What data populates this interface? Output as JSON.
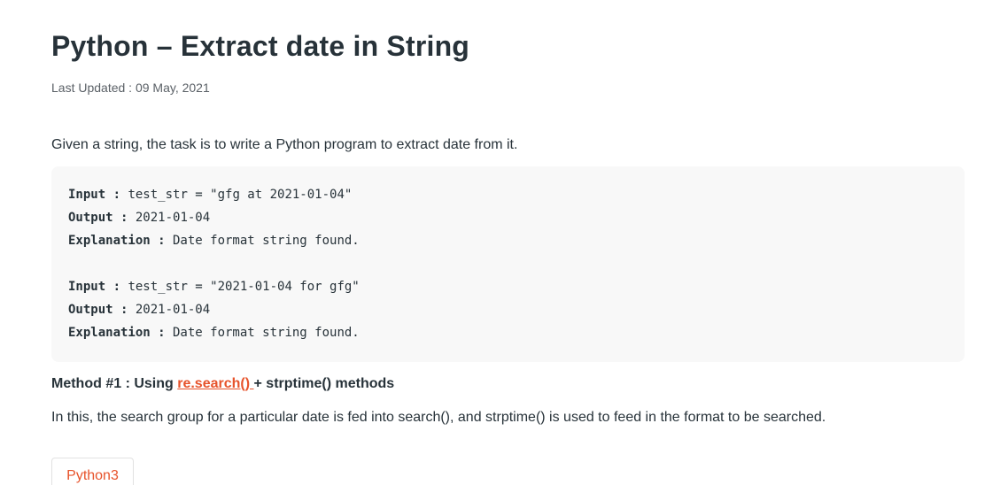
{
  "article": {
    "title": "Python – Extract date in String",
    "last_updated": "Last Updated : 09 May, 2021",
    "intro": "Given a string, the task is to write a Python program to extract date from it.",
    "examples": [
      {
        "input_key": "Input :",
        "input_val": " test_str = \"gfg at 2021-01-04\"",
        "output_key": "Output :",
        "output_val": " 2021-01-04",
        "explanation_key": "Explanation :",
        "explanation_val": " Date format string found."
      },
      {
        "input_key": "Input :",
        "input_val": " test_str = \"2021-01-04 for gfg\"",
        "output_key": "Output :",
        "output_val": " 2021-01-04",
        "explanation_key": "Explanation :",
        "explanation_val": " Date format string found."
      }
    ],
    "method": {
      "prefix": "Method #1 : Using ",
      "link": "re.search() ",
      "suffix": "+ strptime() methods"
    },
    "description": "In this, the search group for a particular date is fed into search(), and strptime() is used to feed in the format to be searched.",
    "code_tab": "Python3"
  },
  "colors": {
    "text": "#273239",
    "accent": "#e7532b",
    "code_bg": "#f8f8f8"
  }
}
